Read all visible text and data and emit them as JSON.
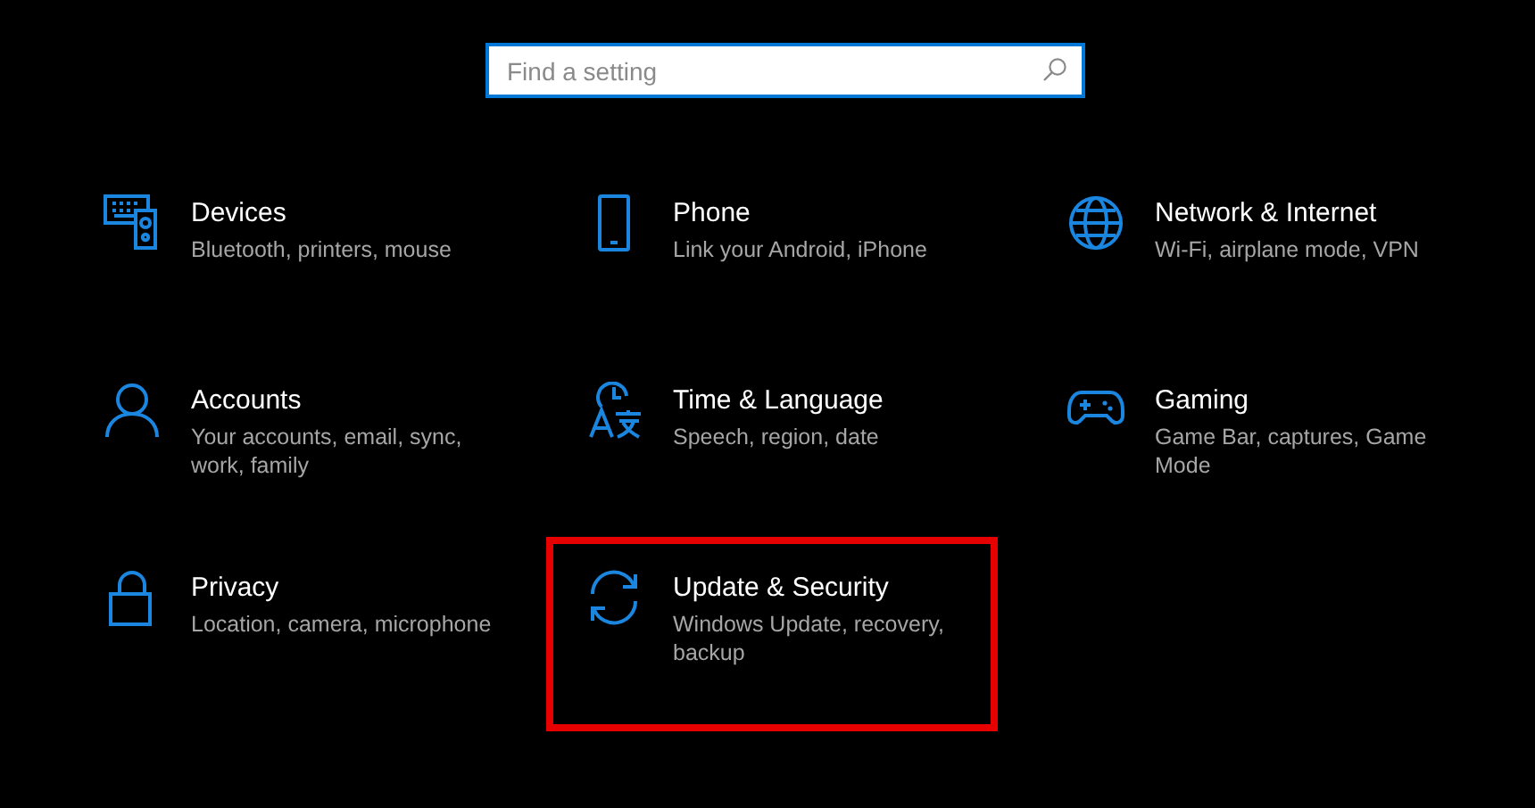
{
  "search": {
    "placeholder": "Find a setting"
  },
  "categories": [
    {
      "kind": "devices",
      "title": "Devices",
      "subtitle": "Bluetooth, printers, mouse",
      "highlighted": false
    },
    {
      "kind": "phone",
      "title": "Phone",
      "subtitle": "Link your Android, iPhone",
      "highlighted": false
    },
    {
      "kind": "network",
      "title": "Network & Internet",
      "subtitle": "Wi-Fi, airplane mode, VPN",
      "highlighted": false
    },
    {
      "kind": "accounts",
      "title": "Accounts",
      "subtitle": "Your accounts, email, sync, work, family",
      "highlighted": false
    },
    {
      "kind": "time",
      "title": "Time & Language",
      "subtitle": "Speech, region, date",
      "highlighted": false
    },
    {
      "kind": "gaming",
      "title": "Gaming",
      "subtitle": "Game Bar, captures, Game Mode",
      "highlighted": false
    },
    {
      "kind": "privacy",
      "title": "Privacy",
      "subtitle": "Location, camera, microphone",
      "highlighted": false
    },
    {
      "kind": "update",
      "title": "Update & Security",
      "subtitle": "Windows Update, recovery, backup",
      "highlighted": true
    }
  ]
}
